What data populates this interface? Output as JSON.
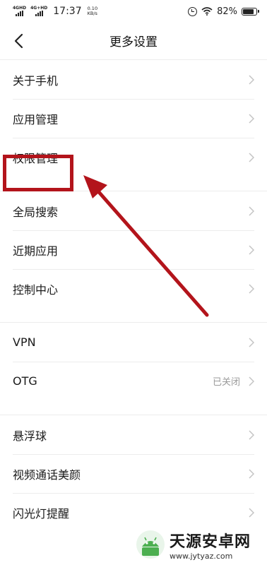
{
  "status_bar": {
    "net1_label": "4GHD",
    "net2_label": "4G+HD",
    "time": "17:37",
    "speed_value": "0.10",
    "speed_unit": "KB/s",
    "battery": "82%",
    "battery_level": 0.82
  },
  "header": {
    "title": "更多设置"
  },
  "groups": [
    [
      {
        "label": "关于手机",
        "value": ""
      },
      {
        "label": "应用管理",
        "value": ""
      },
      {
        "label": "权限管理",
        "value": ""
      }
    ],
    [
      {
        "label": "全局搜索",
        "value": ""
      },
      {
        "label": "近期应用",
        "value": ""
      },
      {
        "label": "控制中心",
        "value": ""
      }
    ],
    [
      {
        "label": "VPN",
        "value": ""
      },
      {
        "label": "OTG",
        "value": "已关闭"
      }
    ],
    [
      {
        "label": "悬浮球",
        "value": ""
      },
      {
        "label": "视频通话美颜",
        "value": ""
      },
      {
        "label": "闪光灯提醒",
        "value": ""
      }
    ]
  ],
  "annotation": {
    "color": "#b3141b"
  },
  "watermark": {
    "name": "天源安卓网",
    "url": "www.jytyaz.com"
  }
}
